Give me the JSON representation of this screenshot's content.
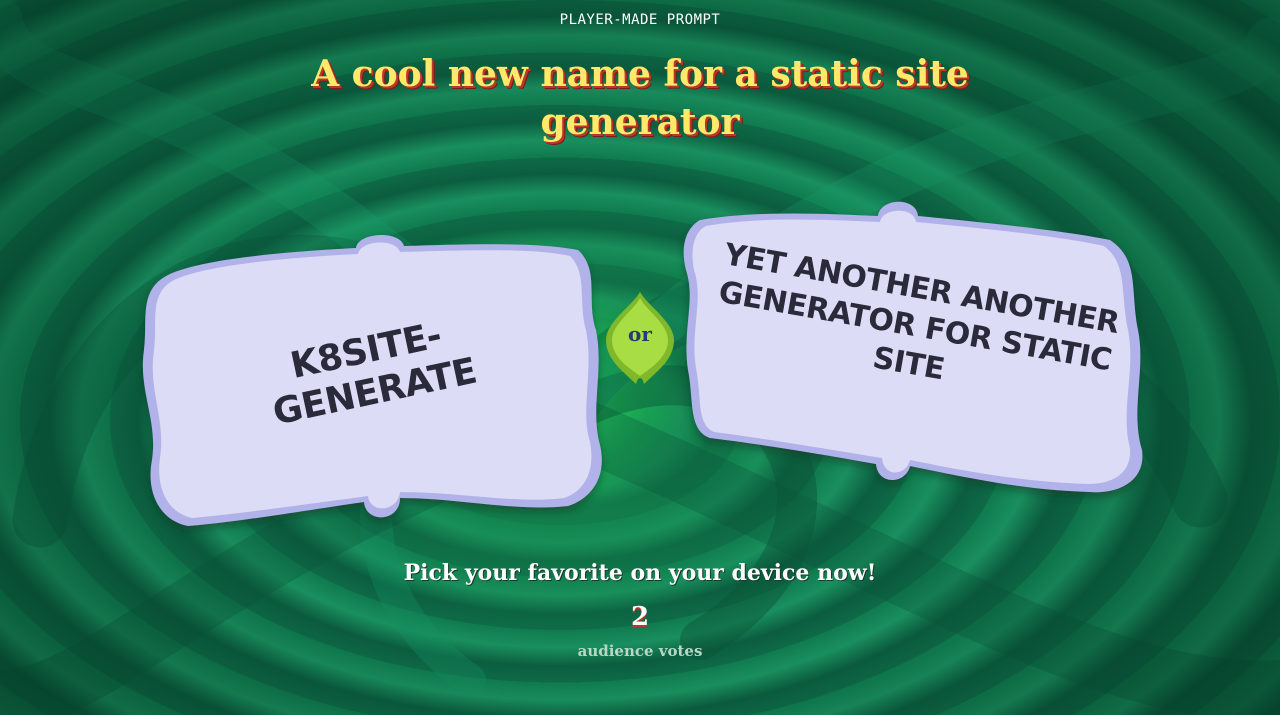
{
  "header": {
    "kicker": "PLAYER-MADE PROMPT",
    "prompt": "A cool new name for a static site generator"
  },
  "answers": [
    {
      "text": "K8SITE-GENERATE"
    },
    {
      "text": "YET ANOTHER ANOTHER GENERATOR FOR STATIC SITE"
    }
  ],
  "divider": {
    "label": "or"
  },
  "footer": {
    "instruction": "Pick your favorite on your device now!",
    "vote_count": "2",
    "vote_label": "audience votes"
  },
  "colors": {
    "background": "#0d6a47",
    "glow": "#48ff7a",
    "prompt_text": "#ffe86a",
    "prompt_shadow": "#c0342a",
    "card_fill": "#dcdcf6",
    "card_edge": "#a9a9e6",
    "card_text": "#2a2a3a",
    "or_badge": "#9fd63a"
  }
}
